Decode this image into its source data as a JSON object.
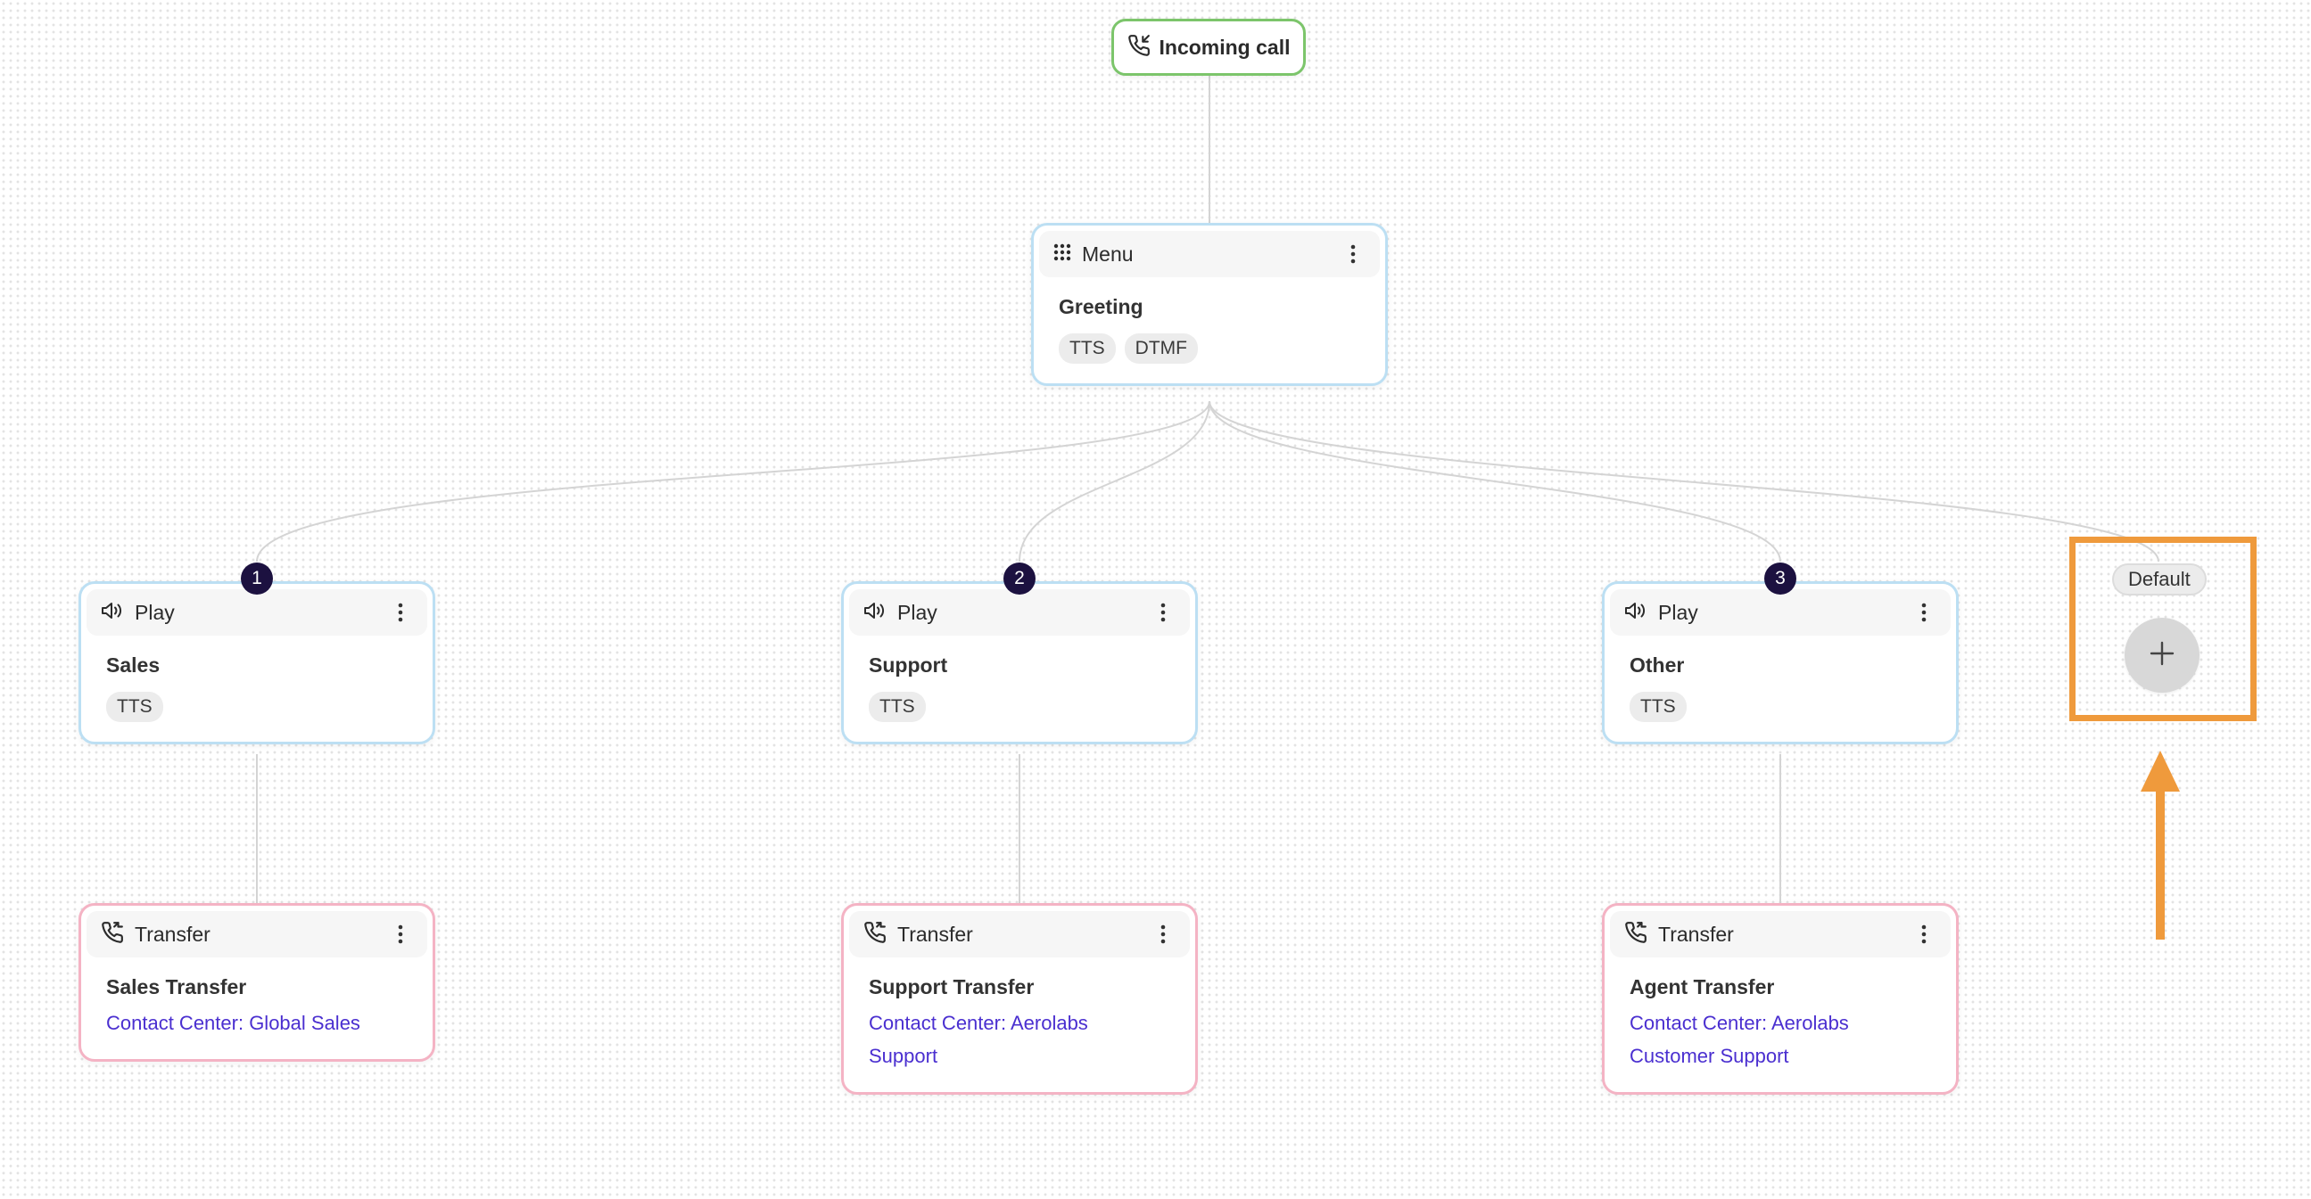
{
  "start": {
    "label": "Incoming call",
    "icon": "phone-incoming-icon"
  },
  "menu_node": {
    "type": "Menu",
    "icon": "dialpad-icon",
    "title": "Greeting",
    "chips": [
      "TTS",
      "DTMF"
    ]
  },
  "play_nodes": [
    {
      "badge": "1",
      "type": "Play",
      "icon": "speaker-icon",
      "title": "Sales",
      "chips": [
        "TTS"
      ]
    },
    {
      "badge": "2",
      "type": "Play",
      "icon": "speaker-icon",
      "title": "Support",
      "chips": [
        "TTS"
      ]
    },
    {
      "badge": "3",
      "type": "Play",
      "icon": "speaker-icon",
      "title": "Other",
      "chips": [
        "TTS"
      ]
    }
  ],
  "transfer_nodes": [
    {
      "type": "Transfer",
      "icon": "phone-transfer-icon",
      "title": "Sales Transfer",
      "target_lines": [
        "Contact Center: Global Sales"
      ]
    },
    {
      "type": "Transfer",
      "icon": "phone-transfer-icon",
      "title": "Support Transfer",
      "target_lines": [
        "Contact Center: Aerolabs",
        "Support"
      ]
    },
    {
      "type": "Transfer",
      "icon": "phone-transfer-icon",
      "title": "Agent Transfer",
      "target_lines": [
        "Contact Center: Aerolabs",
        "Customer Support"
      ]
    }
  ],
  "default_branch": {
    "label": "Default",
    "add_icon": "plus-icon"
  },
  "colors": {
    "start_border": "#7cc56b",
    "play_border": "#bcdff3",
    "transfer_border": "#f4b3c4",
    "link": "#4a2fd0",
    "badge": "#1c1140",
    "highlight": "#ef9a3c"
  }
}
